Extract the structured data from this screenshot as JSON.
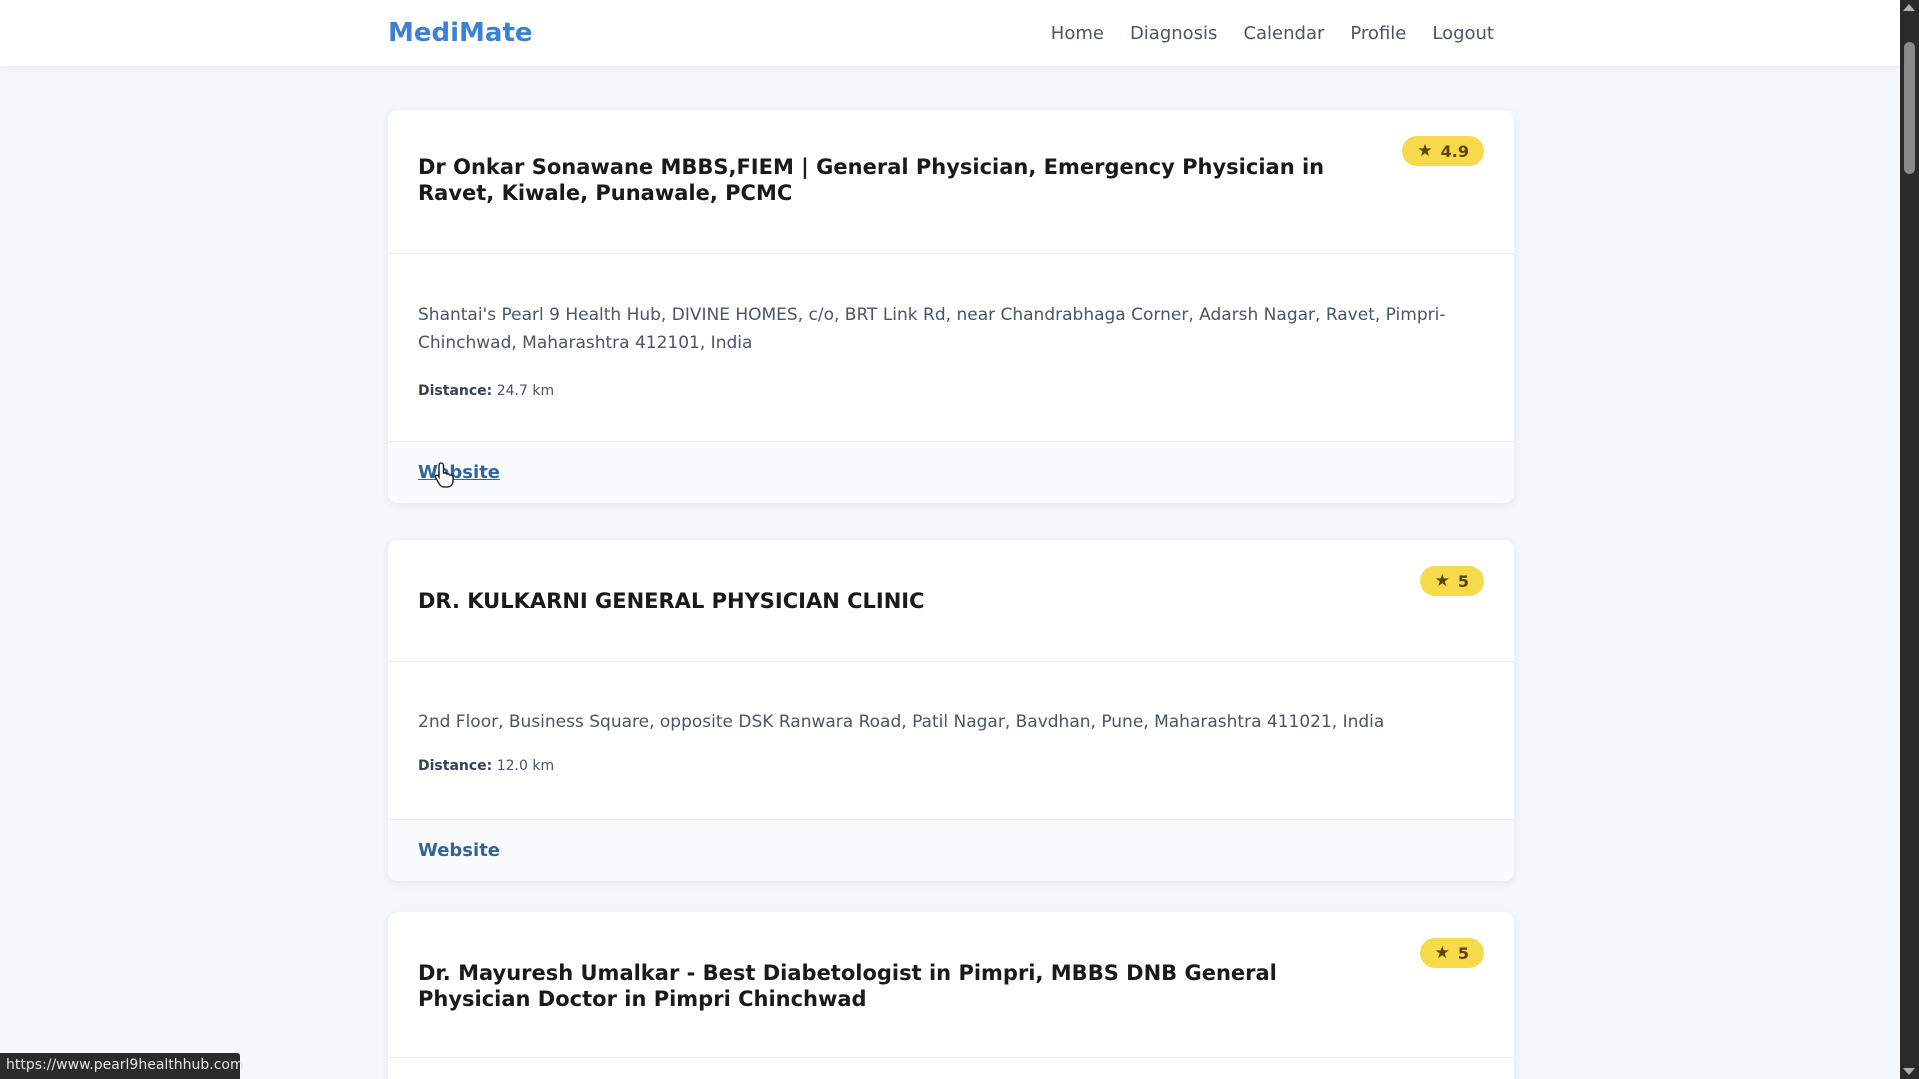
{
  "navbar": {
    "brand": "MediMate",
    "links": [
      "Home",
      "Diagnosis",
      "Calendar",
      "Profile",
      "Logout"
    ]
  },
  "doctors": [
    {
      "name": "Dr Onkar Sonawane MBBS,FIEM | General Physician, Emergency Physician in Ravet, Kiwale, Punawale, PCMC",
      "rating": "4.9",
      "address": "Shantai's Pearl 9 Health Hub, DIVINE HOMES, c/o, BRT Link Rd, near Chandrabhaga Corner, Adarsh Nagar, Ravet, Pimpri-Chinchwad, Maharashtra 412101, India",
      "distance_label": "Distance:",
      "distance_value": "24.7 km",
      "website_label": "Website"
    },
    {
      "name": "DR. KULKARNI GENERAL PHYSICIAN CLINIC",
      "rating": "5",
      "address": "2nd Floor, Business Square, opposite DSK Ranwara Road, Patil Nagar, Bavdhan, Pune, Maharashtra 411021, India",
      "distance_label": "Distance:",
      "distance_value": "12.0 km",
      "website_label": "Website"
    },
    {
      "name": "Dr. Mayuresh Umalkar - Best Diabetologist in Pimpri, MBBS DNB General Physician Doctor in Pimpri Chinchwad",
      "rating": "5"
    }
  ],
  "status_bar": {
    "url": "https://www.pearl9healthhub.com"
  },
  "colors": {
    "brand": "#3b82d6",
    "rating_badge": "#f7d94c",
    "link": "#2f6599",
    "page_bg": "#f5f8fb"
  },
  "icons": {
    "rating": "star-icon"
  }
}
